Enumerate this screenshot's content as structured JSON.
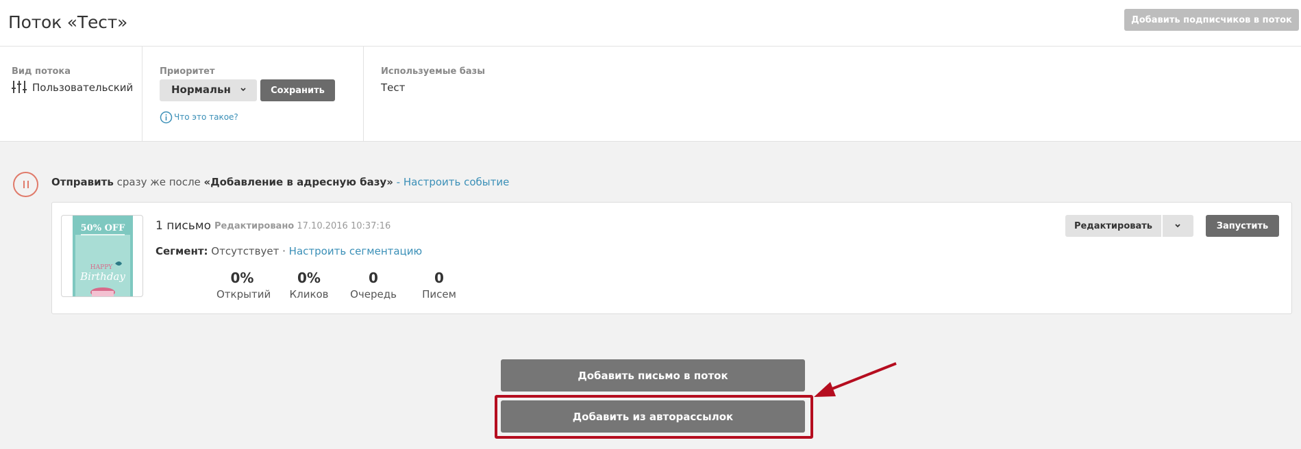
{
  "header": {
    "title": "Поток «Тест»",
    "add_subscribers_label": "Добавить подписчиков в поток"
  },
  "info": {
    "flow_type_label": "Вид потока",
    "flow_type_value": "Пользовательский",
    "priority_label": "Приоритет",
    "priority_value": "Нормальн",
    "save_label": "Сохранить",
    "help_label": "Что это такое?",
    "bases_label": "Используемые базы",
    "bases_value": "Тест"
  },
  "trigger": {
    "send_label": "Отправить",
    "timing": " сразу же после ",
    "event": "«Добавление в адресную базу»",
    "separator": " - ",
    "configure_link": "Настроить событие"
  },
  "letter_card": {
    "thumbnail": {
      "offer": "50% OFF",
      "happy": "HAPPY",
      "birthday": "Birthday"
    },
    "count": "1 письмо",
    "edited_label": "Редактировано",
    "edited_date": "17.10.2016 10:37:16",
    "segment_label": "Сегмент:",
    "segment_value": " Отсутствует · ",
    "segment_link": "Настроить сегментацию",
    "stats": [
      {
        "value": "0%",
        "label": "Открытий"
      },
      {
        "value": "0%",
        "label": "Кликов"
      },
      {
        "value": "0",
        "label": "Очередь"
      },
      {
        "value": "0",
        "label": "Писем"
      }
    ],
    "edit_label": "Редактировать",
    "run_label": "Запустить"
  },
  "actions": {
    "add_letter_label": "Добавить письмо в поток",
    "add_from_auto_label": "Добавить из авторассылок"
  },
  "colors": {
    "link": "#3a8fb7",
    "pause": "#e07a6a",
    "highlight": "#b50d1f",
    "dark_button": "#6b6b6b"
  }
}
